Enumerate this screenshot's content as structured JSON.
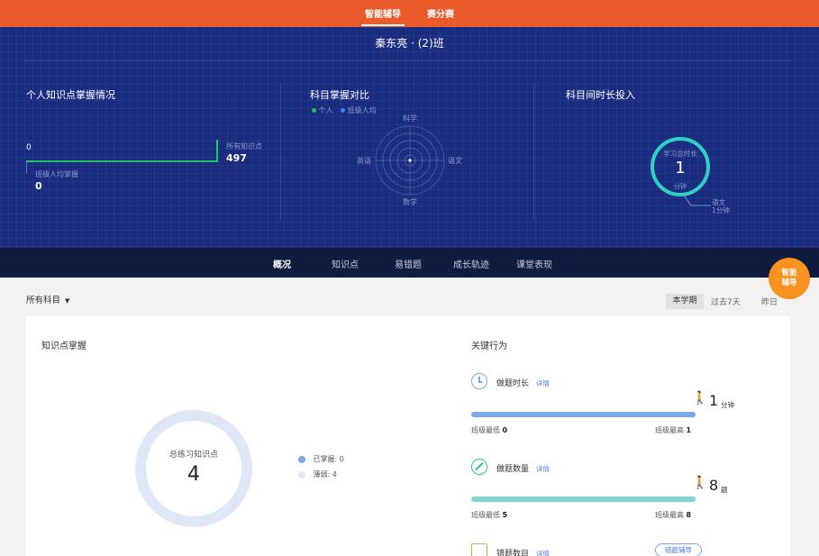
{
  "top_nav": {
    "tabs": [
      {
        "label": "智能辅导",
        "active": true
      },
      {
        "label": "赛分赛",
        "active": false
      }
    ]
  },
  "hero": {
    "class_title": "秦东亮 · (2)班",
    "knowledge": {
      "title": "个人知识点掌握情况",
      "personal_value": "0",
      "total_label": "所有知识点",
      "total_value": "497",
      "class_avg_label": "班级人均掌握",
      "class_avg_value": "0"
    },
    "subject_compare": {
      "title": "科目掌握对比",
      "legend": [
        {
          "label": "个人",
          "color": "#22c55e"
        },
        {
          "label": "班级人均",
          "color": "#3b82f6"
        }
      ],
      "axes": {
        "top": "科学",
        "right": "语文",
        "bottom": "数学",
        "left": "英语"
      }
    },
    "time_invest": {
      "title": "科目间时长投入",
      "ring_label": "学习总时长",
      "ring_value": "1",
      "ring_unit": "分钟",
      "callout_subject": "语文",
      "callout_value": "1分钟"
    }
  },
  "tabs": [
    {
      "label": "概况",
      "active": true
    },
    {
      "label": "知识点",
      "active": false
    },
    {
      "label": "易错题",
      "active": false
    },
    {
      "label": "成长轨迹",
      "active": false
    },
    {
      "label": "课堂表现",
      "active": false
    }
  ],
  "filters": {
    "subject": "所有科目",
    "periods": [
      {
        "label": "本学期",
        "active": true
      },
      {
        "label": "过去7天",
        "active": false
      },
      {
        "label": "昨日",
        "active": false
      }
    ]
  },
  "fab": {
    "line1": "智能",
    "line2": "辅导"
  },
  "mastery": {
    "title": "知识点掌握",
    "center_label": "总练习知识点",
    "center_value": "4",
    "mastered_label": "已掌握: 0",
    "weak_label": "薄弱: 4",
    "mastered_fraction": 0
  },
  "key_behaviors": {
    "title": "关键行为",
    "items": [
      {
        "label": "做题时长",
        "detail": "详情",
        "value": "1",
        "unit": "分钟",
        "min_label": "班级最低",
        "min_value": "0",
        "max_label": "班级最高",
        "max_value": "1",
        "fill_fraction": 1.0,
        "color": "#7aa7ec",
        "icon": "clock-icon"
      },
      {
        "label": "做题数量",
        "detail": "详情",
        "value": "8",
        "unit": "题",
        "min_label": "班级最低",
        "min_value": "5",
        "max_label": "班级最高",
        "max_value": "8",
        "fill_fraction": 1.0,
        "color": "#7fd6d0",
        "icon": "pencil-icon"
      },
      {
        "label": "错题数目",
        "detail": "详情",
        "badge": "错题辅导",
        "icon": "notebook-icon"
      }
    ]
  },
  "colors": {
    "top_nav": "#ea5a2a",
    "hero_bg": "#1a2c80",
    "tab_bar": "#0f1b3f",
    "accent_teal": "#2fd1c4",
    "fab": "#f7931e"
  }
}
